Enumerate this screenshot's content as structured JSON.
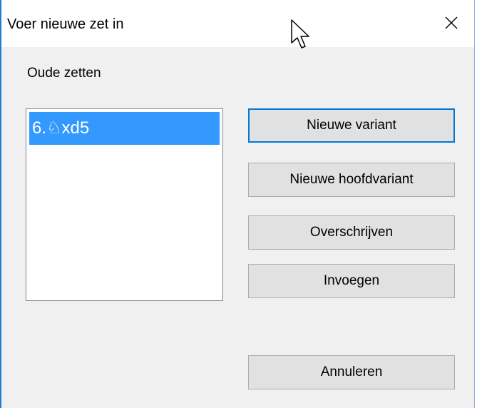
{
  "dialog": {
    "title": "Voer nieuwe zet in",
    "close_icon": "close-icon"
  },
  "old_moves": {
    "label": "Oude zetten",
    "items": [
      "6.♘xd5"
    ],
    "selected_index": 0
  },
  "buttons": {
    "new_variation": "Nieuwe variant",
    "new_main_line": "Nieuwe hoofdvariant",
    "overwrite": "Overschrijven",
    "insert": "Invoegen",
    "cancel": "Annuleren"
  },
  "colors": {
    "selection": "#3399ff",
    "window_border": "#1e7bd6",
    "default_button_border": "#0078d7",
    "dialog_background": "#f0f0f0"
  }
}
